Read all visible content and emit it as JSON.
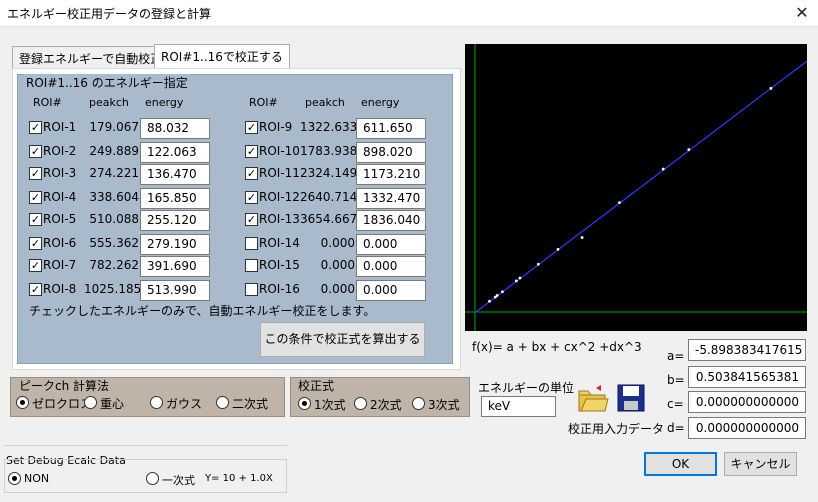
{
  "window": {
    "title": "エネルギー校正用データの登録と計算",
    "close": "✕"
  },
  "tabs": [
    {
      "label": "登録エネルギーで自動校正"
    },
    {
      "label": "ROI#1..16で校正する"
    }
  ],
  "roi_group": {
    "title": "ROI#1..16 のエネルギー指定",
    "headers": {
      "roi": "ROI#",
      "peak": "peakch",
      "energy": "energy"
    },
    "left": [
      {
        "name": "ROI-1",
        "checked": true,
        "peak": "179.067",
        "energy": "88.032"
      },
      {
        "name": "ROI-2",
        "checked": true,
        "peak": "249.889",
        "energy": "122.063"
      },
      {
        "name": "ROI-3",
        "checked": true,
        "peak": "274.221",
        "energy": "136.470"
      },
      {
        "name": "ROI-4",
        "checked": true,
        "peak": "338.604",
        "energy": "165.850"
      },
      {
        "name": "ROI-5",
        "checked": true,
        "peak": "510.088",
        "energy": "255.120"
      },
      {
        "name": "ROI-6",
        "checked": true,
        "peak": "555.362",
        "energy": "279.190"
      },
      {
        "name": "ROI-7",
        "checked": true,
        "peak": "782.262",
        "energy": "391.690"
      },
      {
        "name": "ROI-8",
        "checked": true,
        "peak": "1025.185",
        "energy": "513.990"
      }
    ],
    "right": [
      {
        "name": "ROI-9",
        "checked": true,
        "peak": "1322.633",
        "energy": "611.650"
      },
      {
        "name": "ROI-10",
        "checked": true,
        "peak": "1783.938",
        "energy": "898.020"
      },
      {
        "name": "ROI-11",
        "checked": true,
        "peak": "2324.149",
        "energy": "1173.210"
      },
      {
        "name": "ROI-12",
        "checked": true,
        "peak": "2640.714",
        "energy": "1332.470"
      },
      {
        "name": "ROI-13",
        "checked": true,
        "peak": "3654.667",
        "energy": "1836.040"
      },
      {
        "name": "ROI-14",
        "checked": false,
        "peak": "0.000",
        "energy": "0.000"
      },
      {
        "name": "ROI-15",
        "checked": false,
        "peak": "0.000",
        "energy": "0.000"
      },
      {
        "name": "ROI-16",
        "checked": false,
        "peak": "0.000",
        "energy": "0.000"
      }
    ],
    "note": "チェックしたエネルギーのみで、自動エネルギー校正をします。",
    "calc_button": "この条件で校正式を算出する"
  },
  "peak_method": {
    "title": "ピークch 計算法",
    "options": [
      "ゼロクロス",
      "重心",
      "ガウス",
      "二次式"
    ],
    "selected": "ゼロクロス"
  },
  "calib_formula": {
    "title": "校正式",
    "options": [
      "1次式",
      "2次式",
      "3次式"
    ],
    "selected": "1次式"
  },
  "energy_unit": {
    "label": "エネルギーの単位",
    "value": "keV"
  },
  "calib_input_label": "校正用入力データ",
  "formula_text": "f(x)= a + bx + cx^2 +dx^3",
  "coefficients": [
    {
      "label": "a=",
      "value": "-5.898383417615"
    },
    {
      "label": "b=",
      "value": "0.503841565381"
    },
    {
      "label": "c=",
      "value": "0.000000000000"
    },
    {
      "label": "d=",
      "value": "0.000000000000"
    }
  ],
  "buttons": {
    "ok": "OK",
    "cancel": "キャンセル"
  },
  "debug": {
    "title": "Set Debug Ecalc  Data",
    "options": [
      "NON",
      "一次式"
    ],
    "selected": "NON",
    "formula": "Y= 10 + 1.0X"
  },
  "colors": {
    "plot_bg": "#000000",
    "fit_line": "#2a3cff",
    "axis": "#00aa00",
    "points": "#ffffff",
    "group_bg": "#a9bacd",
    "option_panel_bg": "#c0b4a8"
  },
  "chart_data": {
    "type": "scatter",
    "x": [
      179.067,
      249.889,
      274.221,
      338.604,
      510.088,
      555.362,
      782.262,
      1025.185,
      1322.633,
      1783.938,
      2324.149,
      2640.714,
      3654.667
    ],
    "y": [
      88.032,
      122.063,
      136.47,
      165.85,
      255.12,
      279.19,
      391.69,
      513.99,
      611.65,
      898.02,
      1173.21,
      1332.47,
      1836.04
    ],
    "xlim": [
      0,
      4100
    ],
    "ylim": [
      0,
      2200
    ],
    "fit": {
      "a": -5.898383417615,
      "b": 0.503841565381
    }
  }
}
